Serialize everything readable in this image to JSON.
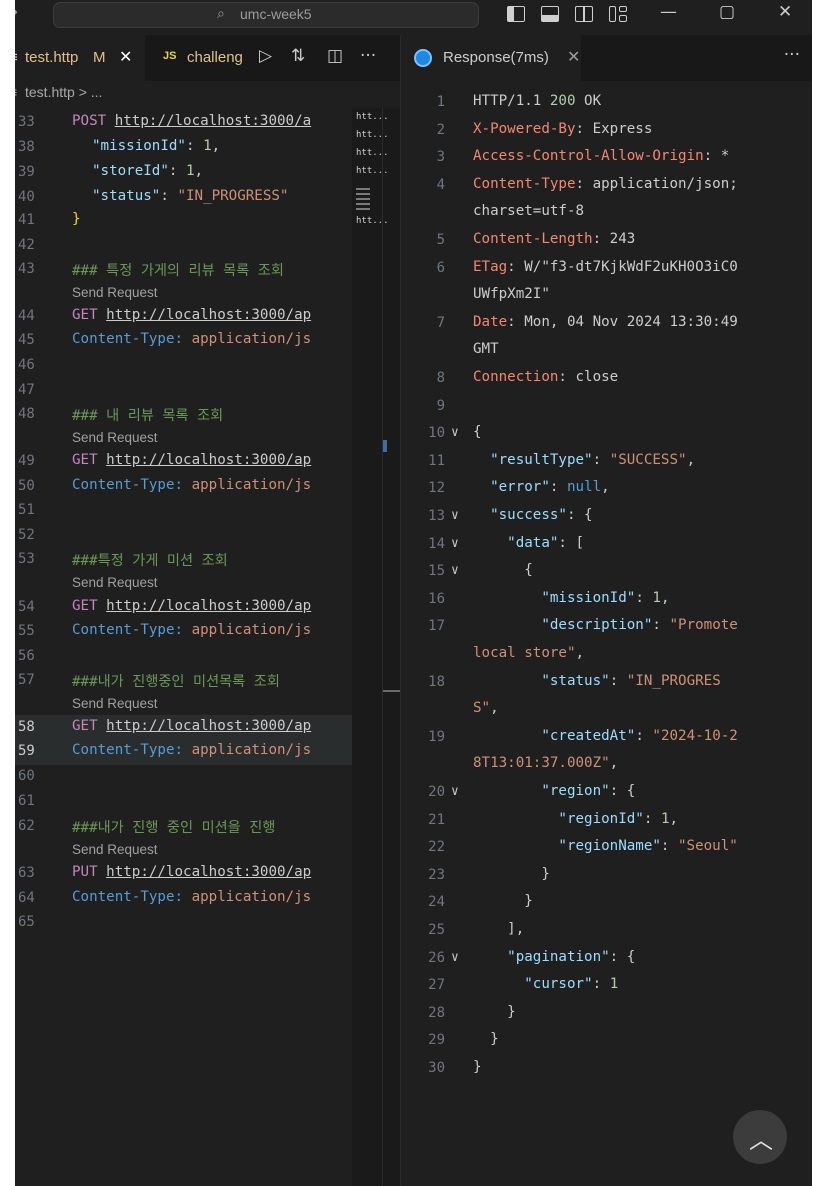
{
  "titlebar": {
    "command_center_text": "umc-week5",
    "back_icon": "arrow-right-icon",
    "controls": {
      "minimize": "—",
      "maximize": "▢",
      "close": "✕"
    }
  },
  "editor": {
    "tabs": [
      {
        "label": "test.http",
        "modified": "M",
        "close": "✕",
        "prefix": "≡"
      },
      {
        "label": "challeng",
        "badge": "JS"
      }
    ],
    "breadcrumb": "test.http > ...",
    "lines": {
      "l33": {
        "no": "33",
        "method": "POST",
        "url": "http://localhost:3000/a"
      },
      "l38": {
        "no": "38",
        "key": "\"missionId\"",
        "sep": ": ",
        "val": "1",
        "end": ","
      },
      "l39": {
        "no": "39",
        "key": "\"storeId\"",
        "sep": ": ",
        "val": "1",
        "end": ","
      },
      "l40": {
        "no": "40",
        "key": "\"status\"",
        "sep": ": ",
        "val": "\"IN_PROGRESS\""
      },
      "l41": {
        "no": "41",
        "brace": "}"
      },
      "l42": {
        "no": "42"
      },
      "l43": {
        "no": "43",
        "comment": "### 특정 가게의 리뷰 목록 조회"
      },
      "l44": {
        "no": "44",
        "method": "GET",
        "url": "http://localhost:3000/ap"
      },
      "l45": {
        "no": "45",
        "hkey": "Content-Type:",
        "hval": " application/js"
      },
      "l46": {
        "no": "46"
      },
      "l47": {
        "no": "47"
      },
      "l48": {
        "no": "48",
        "comment": "### 내 리뷰 목록 조회"
      },
      "l49": {
        "no": "49",
        "method": "GET",
        "url": "http://localhost:3000/ap"
      },
      "l50": {
        "no": "50",
        "hkey": "Content-Type:",
        "hval": " application/js"
      },
      "l51": {
        "no": "51"
      },
      "l52": {
        "no": "52"
      },
      "l53": {
        "no": "53",
        "comment": "###특정 가게 미션 조회"
      },
      "l54": {
        "no": "54",
        "method": "GET",
        "url": "http://localhost:3000/ap"
      },
      "l55": {
        "no": "55",
        "hkey": "Content-Type:",
        "hval": " application/js"
      },
      "l56": {
        "no": "56"
      },
      "l57": {
        "no": "57",
        "comment": "###내가 진행중인 미션목록 조회"
      },
      "l58": {
        "no": "58",
        "method": "GET",
        "url": "http://localhost:3000/ap"
      },
      "l59": {
        "no": "59",
        "hkey": "Content-Type:",
        "hval": " application/js"
      },
      "l60": {
        "no": "60"
      },
      "l61": {
        "no": "61"
      },
      "l62": {
        "no": "62",
        "comment": "###내가 진행 중인 미션을 진행"
      },
      "l63": {
        "no": "63",
        "method": "PUT",
        "url": "http://localhost:3000/ap"
      },
      "l64": {
        "no": "64",
        "hkey": "Content-Type:",
        "hval": " application/js"
      },
      "l65": {
        "no": "65"
      }
    },
    "codelens": "Send Request",
    "minimap": [
      "htt...",
      "htt...",
      "htt...",
      "htt...",
      "htt..."
    ]
  },
  "response": {
    "tab_label": "Response(7ms)",
    "close": "✕",
    "more": "···",
    "lines": [
      {
        "no": "1",
        "parts": [
          [
            "http-ver",
            "HTTP/1.1 "
          ],
          [
            "http-code",
            "200"
          ],
          [
            "hv",
            " OK"
          ]
        ]
      },
      {
        "no": "2",
        "parts": [
          [
            "hk",
            "X-Powered-By"
          ],
          [
            "hv",
            ": Express"
          ]
        ]
      },
      {
        "no": "3",
        "parts": [
          [
            "hk",
            "Access-Control-Allow-Origin"
          ],
          [
            "hv",
            ": *"
          ]
        ]
      },
      {
        "no": "4",
        "parts": [
          [
            "hk",
            "Content-Type"
          ],
          [
            "hv",
            ": application/json;"
          ]
        ]
      },
      {
        "no": "",
        "parts": [
          [
            "hv",
            "charset=utf-8"
          ]
        ]
      },
      {
        "no": "5",
        "parts": [
          [
            "hk",
            "Content-Length"
          ],
          [
            "hv",
            ": 243"
          ]
        ]
      },
      {
        "no": "6",
        "parts": [
          [
            "hk",
            "ETag"
          ],
          [
            "hv",
            ": W/\"f3-dt7KjkWdF2uKH0O3iC0"
          ]
        ]
      },
      {
        "no": "",
        "parts": [
          [
            "hv",
            "UWfpXm2I\""
          ]
        ]
      },
      {
        "no": "7",
        "parts": [
          [
            "hk",
            "Date"
          ],
          [
            "hv",
            ": Mon, 04 Nov 2024 13:30:49"
          ]
        ]
      },
      {
        "no": "",
        "parts": [
          [
            "hv",
            "GMT"
          ]
        ]
      },
      {
        "no": "8",
        "parts": [
          [
            "hk",
            "Connection"
          ],
          [
            "hv",
            ": close"
          ]
        ]
      },
      {
        "no": "9",
        "parts": []
      },
      {
        "no": "10",
        "fold": "∨",
        "parts": [
          [
            "jbr",
            "{"
          ]
        ]
      },
      {
        "no": "11",
        "parts": [
          [
            "jb",
            "  "
          ],
          [
            "jk",
            "\"resultType\""
          ],
          [
            "jb",
            ": "
          ],
          [
            "js",
            "\"SUCCESS\""
          ],
          [
            "jb",
            ","
          ]
        ]
      },
      {
        "no": "12",
        "parts": [
          [
            "jb",
            "  "
          ],
          [
            "jk",
            "\"error\""
          ],
          [
            "jb",
            ": "
          ],
          [
            "jnull",
            "null"
          ],
          [
            "jb",
            ","
          ]
        ]
      },
      {
        "no": "13",
        "fold": "∨",
        "parts": [
          [
            "jb",
            "  "
          ],
          [
            "jk",
            "\"success\""
          ],
          [
            "jb",
            ": {"
          ]
        ]
      },
      {
        "no": "14",
        "fold": "∨",
        "parts": [
          [
            "jb",
            "    "
          ],
          [
            "jk",
            "\"data\""
          ],
          [
            "jb",
            ": ["
          ]
        ]
      },
      {
        "no": "15",
        "fold": "∨",
        "parts": [
          [
            "jb",
            "      {"
          ]
        ]
      },
      {
        "no": "16",
        "parts": [
          [
            "jb",
            "        "
          ],
          [
            "jk",
            "\"missionId\""
          ],
          [
            "jb",
            ": "
          ],
          [
            "jn",
            "1"
          ],
          [
            "jb",
            ","
          ]
        ]
      },
      {
        "no": "17",
        "parts": [
          [
            "jb",
            "        "
          ],
          [
            "jk",
            "\"description\""
          ],
          [
            "jb",
            ": "
          ],
          [
            "js",
            "\"Promote"
          ]
        ]
      },
      {
        "no": "",
        "parts": [
          [
            "js",
            "local store\""
          ],
          [
            "jb",
            ","
          ]
        ]
      },
      {
        "no": "18",
        "parts": [
          [
            "jb",
            "        "
          ],
          [
            "jk",
            "\"status\""
          ],
          [
            "jb",
            ": "
          ],
          [
            "js",
            "\"IN_PROGRES"
          ]
        ]
      },
      {
        "no": "",
        "parts": [
          [
            "js",
            "S\""
          ],
          [
            "jb",
            ","
          ]
        ]
      },
      {
        "no": "19",
        "parts": [
          [
            "jb",
            "        "
          ],
          [
            "jk",
            "\"createdAt\""
          ],
          [
            "jb",
            ": "
          ],
          [
            "js",
            "\"2024-10-2"
          ]
        ]
      },
      {
        "no": "",
        "parts": [
          [
            "js",
            "8T13:01:37.000Z\""
          ],
          [
            "jb",
            ","
          ]
        ]
      },
      {
        "no": "20",
        "fold": "∨",
        "parts": [
          [
            "jb",
            "        "
          ],
          [
            "jk",
            "\"region\""
          ],
          [
            "jb",
            ": {"
          ]
        ]
      },
      {
        "no": "21",
        "parts": [
          [
            "jb",
            "          "
          ],
          [
            "jk",
            "\"regionId\""
          ],
          [
            "jb",
            ": "
          ],
          [
            "jn",
            "1"
          ],
          [
            "jb",
            ","
          ]
        ]
      },
      {
        "no": "22",
        "parts": [
          [
            "jb",
            "          "
          ],
          [
            "jk",
            "\"regionName\""
          ],
          [
            "jb",
            ": "
          ],
          [
            "js",
            "\"Seoul\""
          ]
        ]
      },
      {
        "no": "23",
        "parts": [
          [
            "jb",
            "        }"
          ]
        ]
      },
      {
        "no": "24",
        "parts": [
          [
            "jb",
            "      }"
          ]
        ]
      },
      {
        "no": "25",
        "parts": [
          [
            "jb",
            "    ],"
          ]
        ]
      },
      {
        "no": "26",
        "fold": "∨",
        "parts": [
          [
            "jb",
            "    "
          ],
          [
            "jk",
            "\"pagination\""
          ],
          [
            "jb",
            ": {"
          ]
        ]
      },
      {
        "no": "27",
        "parts": [
          [
            "jb",
            "      "
          ],
          [
            "jk",
            "\"cursor\""
          ],
          [
            "jb",
            ": "
          ],
          [
            "jn",
            "1"
          ]
        ]
      },
      {
        "no": "28",
        "parts": [
          [
            "jb",
            "    }"
          ]
        ]
      },
      {
        "no": "29",
        "parts": [
          [
            "jb",
            "  }"
          ]
        ]
      },
      {
        "no": "30",
        "parts": [
          [
            "jb",
            "}"
          ]
        ]
      }
    ]
  },
  "scroll_top_button": "︿"
}
